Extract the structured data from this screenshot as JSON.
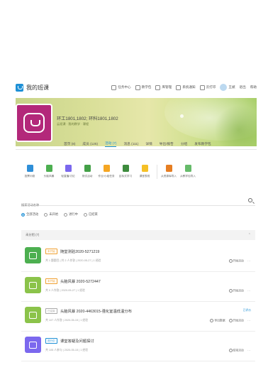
{
  "app": {
    "title": "我的班课"
  },
  "topnav": [
    {
      "label": "任务中心"
    },
    {
      "label": "教学包"
    },
    {
      "label": "库管理"
    },
    {
      "label": "系统通知"
    },
    {
      "label": "云打印"
    },
    {
      "label": "王斌"
    },
    {
      "label": "退出"
    },
    {
      "label": "帮助"
    }
  ],
  "class": {
    "title": "环工1801,1802; 环科1801,1802",
    "subtitle": "云班课 · 我的教学 · 课程"
  },
  "subnav": [
    {
      "label": "首页 (8)"
    },
    {
      "label": "成员 (125)"
    },
    {
      "label": "活动 (7)",
      "active": true
    },
    {
      "label": "消息 (111)"
    },
    {
      "label": "详情"
    },
    {
      "label": "导出/报告"
    },
    {
      "label": "分组"
    },
    {
      "label": "发布教学包"
    }
  ],
  "tools": [
    {
      "label": "投票问卷",
      "color": "#2f8fd8"
    },
    {
      "label": "头脑风暴",
      "color": "#4caf50"
    },
    {
      "label": "轻直播/讨论",
      "color": "#7b68ee"
    },
    {
      "label": "测试活动",
      "color": "#43a047"
    },
    {
      "label": "作业/小组任务",
      "color": "#f5a623"
    },
    {
      "label": "目标式学习",
      "color": "#3d8b3d"
    },
    {
      "label": "课堂表现",
      "color": "#f5c026"
    },
    {
      "label": "从资源库导入",
      "color": "#e67e22"
    },
    {
      "label": "从教学包导入",
      "color": "#66bb6a"
    }
  ],
  "search": {
    "placeholder": "搜索活动名称"
  },
  "filters": [
    {
      "label": "全部活动",
      "on": true
    },
    {
      "label": "未开始",
      "on": false
    },
    {
      "label": "进行中",
      "on": false
    },
    {
      "label": "已结束",
      "on": false
    }
  ],
  "group": {
    "label": "未分组 (7)"
  },
  "rows": [
    {
      "badge": "未开始",
      "badge_color": "#f0a030",
      "name": "随堂测验2020-5271219",
      "meta": "共 1 题题目 | 共 2 人作答 | 2020-05-27 | 1 经验",
      "thumb_color": "#4caf50",
      "action": "开始活动",
      "more": "···",
      "extra": ""
    },
    {
      "badge": "未开始",
      "badge_color": "#f0a030",
      "name": "头脑风暴 2020-5272447",
      "meta": "共 0 人作答 | 2020-05-27 | 1 经验",
      "thumb_color": "#8bc34a",
      "action": "开始活动",
      "more": "···",
      "extra": ""
    },
    {
      "badge": "已结束",
      "badge_color": "#aaaaaa",
      "name": "头脑风暴 2020-4463015-强化室温低温分布",
      "meta": "共 107 人作答 | 2020-05-15 | 1 经验",
      "thumb_color": "#8bc34a",
      "action": "开始活动",
      "more": "···",
      "extra": "已评价",
      "action2": "导出数据"
    },
    {
      "badge": "进行中",
      "badge_color": "#1e90d6",
      "name": "课堂答疑及问题探讨",
      "meta": "共 105 人参与 | 2020-05-15 | 1 经验",
      "thumb_color": "#7b68ee",
      "action": "结束活动",
      "more": "···",
      "extra": ""
    }
  ]
}
